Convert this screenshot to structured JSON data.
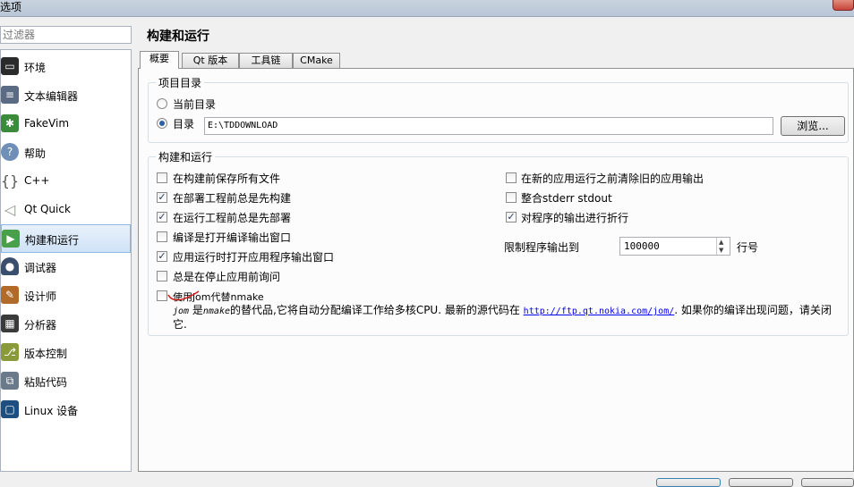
{
  "window": {
    "title": "选项"
  },
  "filter": {
    "placeholder": "过滤器"
  },
  "sidebar": {
    "items": [
      {
        "label": "环境",
        "icon": "monitor-icon",
        "color": "#2b2b2b"
      },
      {
        "label": "文本编辑器",
        "icon": "text-editor-icon",
        "color": "#5b6b84"
      },
      {
        "label": "FakeVim",
        "icon": "fakevim-icon",
        "color": "#3c8a3c"
      },
      {
        "label": "帮助",
        "icon": "help-icon",
        "color": "#6f8fb8"
      },
      {
        "label": "C++",
        "icon": "cpp-icon",
        "color": "#8a8a8a"
      },
      {
        "label": "Qt Quick",
        "icon": "qt-quick-icon",
        "color": "#9aa39a"
      },
      {
        "label": "构建和运行",
        "icon": "build-run-icon",
        "color": "#4aa04a",
        "selected": true
      },
      {
        "label": "调试器",
        "icon": "debugger-icon",
        "color": "#3a4f6e"
      },
      {
        "label": "设计师",
        "icon": "designer-icon",
        "color": "#b06a2a"
      },
      {
        "label": "分析器",
        "icon": "analyzer-icon",
        "color": "#3a3a3a"
      },
      {
        "label": "版本控制",
        "icon": "version-control-icon",
        "color": "#8a9a3a"
      },
      {
        "label": "粘贴代码",
        "icon": "paste-code-icon",
        "color": "#6a7a8a"
      },
      {
        "label": "Linux 设备",
        "icon": "linux-device-icon",
        "color": "#1f4f7f"
      }
    ]
  },
  "page": {
    "title": "构建和运行"
  },
  "tabs": [
    "概要",
    "Qt 版本",
    "工具链",
    "CMake"
  ],
  "project_dir": {
    "title": "项目目录",
    "current_label": "当前目录",
    "dir_label": "目录",
    "dir_value": "E:\\TDDOWNLOAD",
    "browse_label": "浏览..."
  },
  "build_run": {
    "title": "构建和运行",
    "left_options": [
      {
        "label": "在构建前保存所有文件",
        "checked": false
      },
      {
        "label": "在部署工程前总是先构建",
        "checked": true
      },
      {
        "label": "在运行工程前总是先部署",
        "checked": true
      },
      {
        "label": "编译是打开编译输出窗口",
        "checked": false
      },
      {
        "label": "应用运行时打开应用程序输出窗口",
        "checked": true
      },
      {
        "label": "总是在停止应用前询问",
        "checked": false
      },
      {
        "label": "使用jom代替nmake",
        "checked": false
      }
    ],
    "right_options": [
      {
        "label": "在新的应用运行之前清除旧的应用输出",
        "checked": false
      },
      {
        "label": "整合stderr stdout",
        "checked": false
      },
      {
        "label": "对程序的输出进行折行",
        "checked": true
      }
    ],
    "limit_label": "限制程序输出到",
    "limit_value": "100000",
    "limit_unit": "行号",
    "jom_desc_jom": "jom",
    "jom_desc_1": " 是",
    "jom_desc_nmake": "nmake",
    "jom_desc_2": "的替代品,它将自动分配编译工作给多核CPU. 最新的源代码在 ",
    "jom_link": "http://ftp.qt.nokia.com/jom/",
    "jom_desc_3": ". 如果你的编译出现问题，请关闭它."
  }
}
